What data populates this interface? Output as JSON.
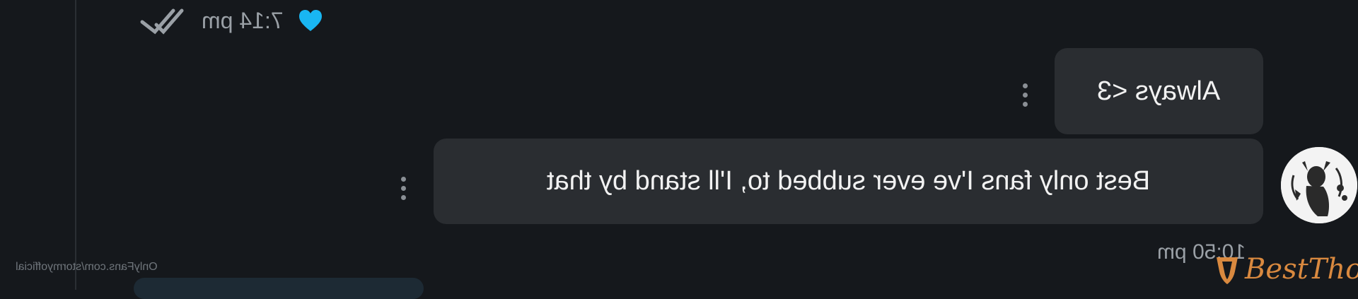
{
  "messages": [
    {
      "text": "Always <3"
    },
    {
      "text": "Best only fans I've ever subbed to, I'll stand by that",
      "time": "10:50 pm"
    }
  ],
  "top_status": {
    "time": "7:14 pm",
    "icons": [
      "heart-icon",
      "double-check-icon"
    ]
  },
  "watermarks": {
    "url": "OnlyFans.com/stormyofficial",
    "brand": "BestThot"
  },
  "colors": {
    "background": "#15181c",
    "bubble": "#2a2d31",
    "heart": "#19b6f2",
    "muted_text": "#9aa0a6",
    "brand": "#d9893f"
  }
}
